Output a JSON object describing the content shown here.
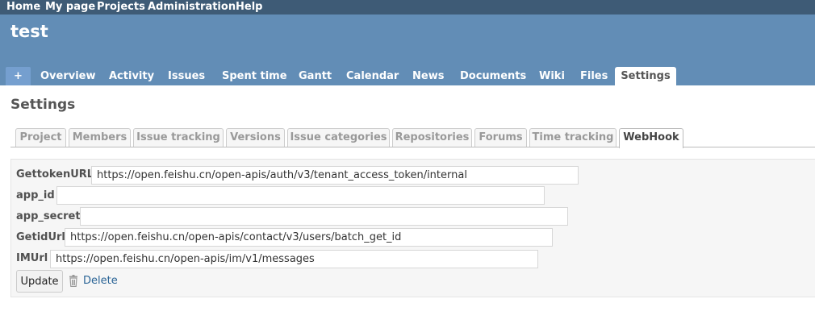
{
  "top_menu": {
    "items": [
      "Home",
      "My page",
      "Projects",
      "Administration",
      "Help"
    ]
  },
  "project": {
    "title": "test"
  },
  "main_tabs": {
    "new_label": "+",
    "items": [
      "Overview",
      "Activity",
      "Issues",
      "Spent time",
      "Gantt",
      "Calendar",
      "News",
      "Documents",
      "Wiki",
      "Files",
      "Settings"
    ],
    "selected": "Settings"
  },
  "page": {
    "heading": "Settings"
  },
  "settings_tabs": {
    "items": [
      "Project",
      "Members",
      "Issue tracking",
      "Versions",
      "Issue categories",
      "Repositories",
      "Forums",
      "Time tracking",
      "WebHook"
    ],
    "selected": "WebHook"
  },
  "webhook_form": {
    "fields": [
      {
        "label": "GettokenURL",
        "value": "https://open.feishu.cn/open-apis/auth/v3/tenant_access_token/internal"
      },
      {
        "label": "app_id",
        "value": ""
      },
      {
        "label": "app_secret",
        "value": ""
      },
      {
        "label": "GetidUrl",
        "value": "https://open.feishu.cn/open-apis/contact/v3/users/batch_get_id"
      },
      {
        "label": "IMUrl",
        "value": "https://open.feishu.cn/open-apis/im/v1/messages"
      }
    ],
    "update_label": "Update",
    "delete_label": "Delete",
    "delete_icon": "trash-icon"
  },
  "colors": {
    "top_menu_bg": "#3e5b76",
    "header_bg": "#628db6",
    "link": "#2a6496"
  }
}
